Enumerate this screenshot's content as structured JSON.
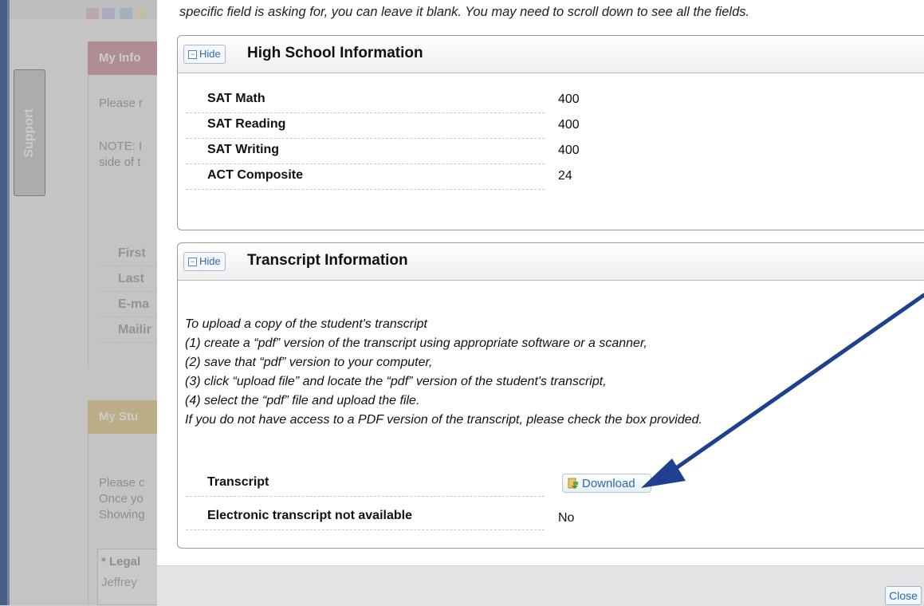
{
  "support_tab": {
    "label": "Support"
  },
  "background_page": {
    "section1_header": "My Info",
    "section1_text1": "Please r",
    "section1_text2a": "NOTE: I",
    "section1_text2b": "side of t",
    "fields": [
      "First",
      "Last",
      "E-ma",
      "Mailir"
    ],
    "section2_header": "My Stu",
    "section2_text1": "Please c",
    "section2_text2": "Once yo",
    "section2_text3": "Showing",
    "legal_label": "* Legal",
    "legal_value": "Jeffrey"
  },
  "modal": {
    "intro": "specific field is asking for, you can leave it blank. You may need to scroll down to see all the fields.",
    "high_school": {
      "hide_label": "Hide",
      "title": "High School Information",
      "rows": [
        {
          "label": "SAT Math",
          "value": "400"
        },
        {
          "label": "SAT Reading",
          "value": "400"
        },
        {
          "label": "SAT Writing",
          "value": "400"
        },
        {
          "label": "ACT Composite",
          "value": "24"
        }
      ]
    },
    "transcript": {
      "hide_label": "Hide",
      "title": "Transcript Information",
      "instructions": [
        "To upload a copy of the student's transcript",
        "(1) create a “pdf” version of the transcript using appropriate software or a scanner,",
        "(2) save that “pdf” version to your computer,",
        "(3) click “upload file” and locate the “pdf” version of the student's transcript,",
        "(4) select the “pdf” file and upload the file.",
        "If you do not have access to a PDF version of the transcript, please check the box provided."
      ],
      "transcript_label": "Transcript",
      "download_label": "Download",
      "electronic_label": "Electronic transcript not available",
      "electronic_value": "No"
    },
    "close_label": "Close"
  },
  "colors": {
    "annotation_arrow": "#1f3f8f",
    "link_blue": "#2a6ab0"
  }
}
